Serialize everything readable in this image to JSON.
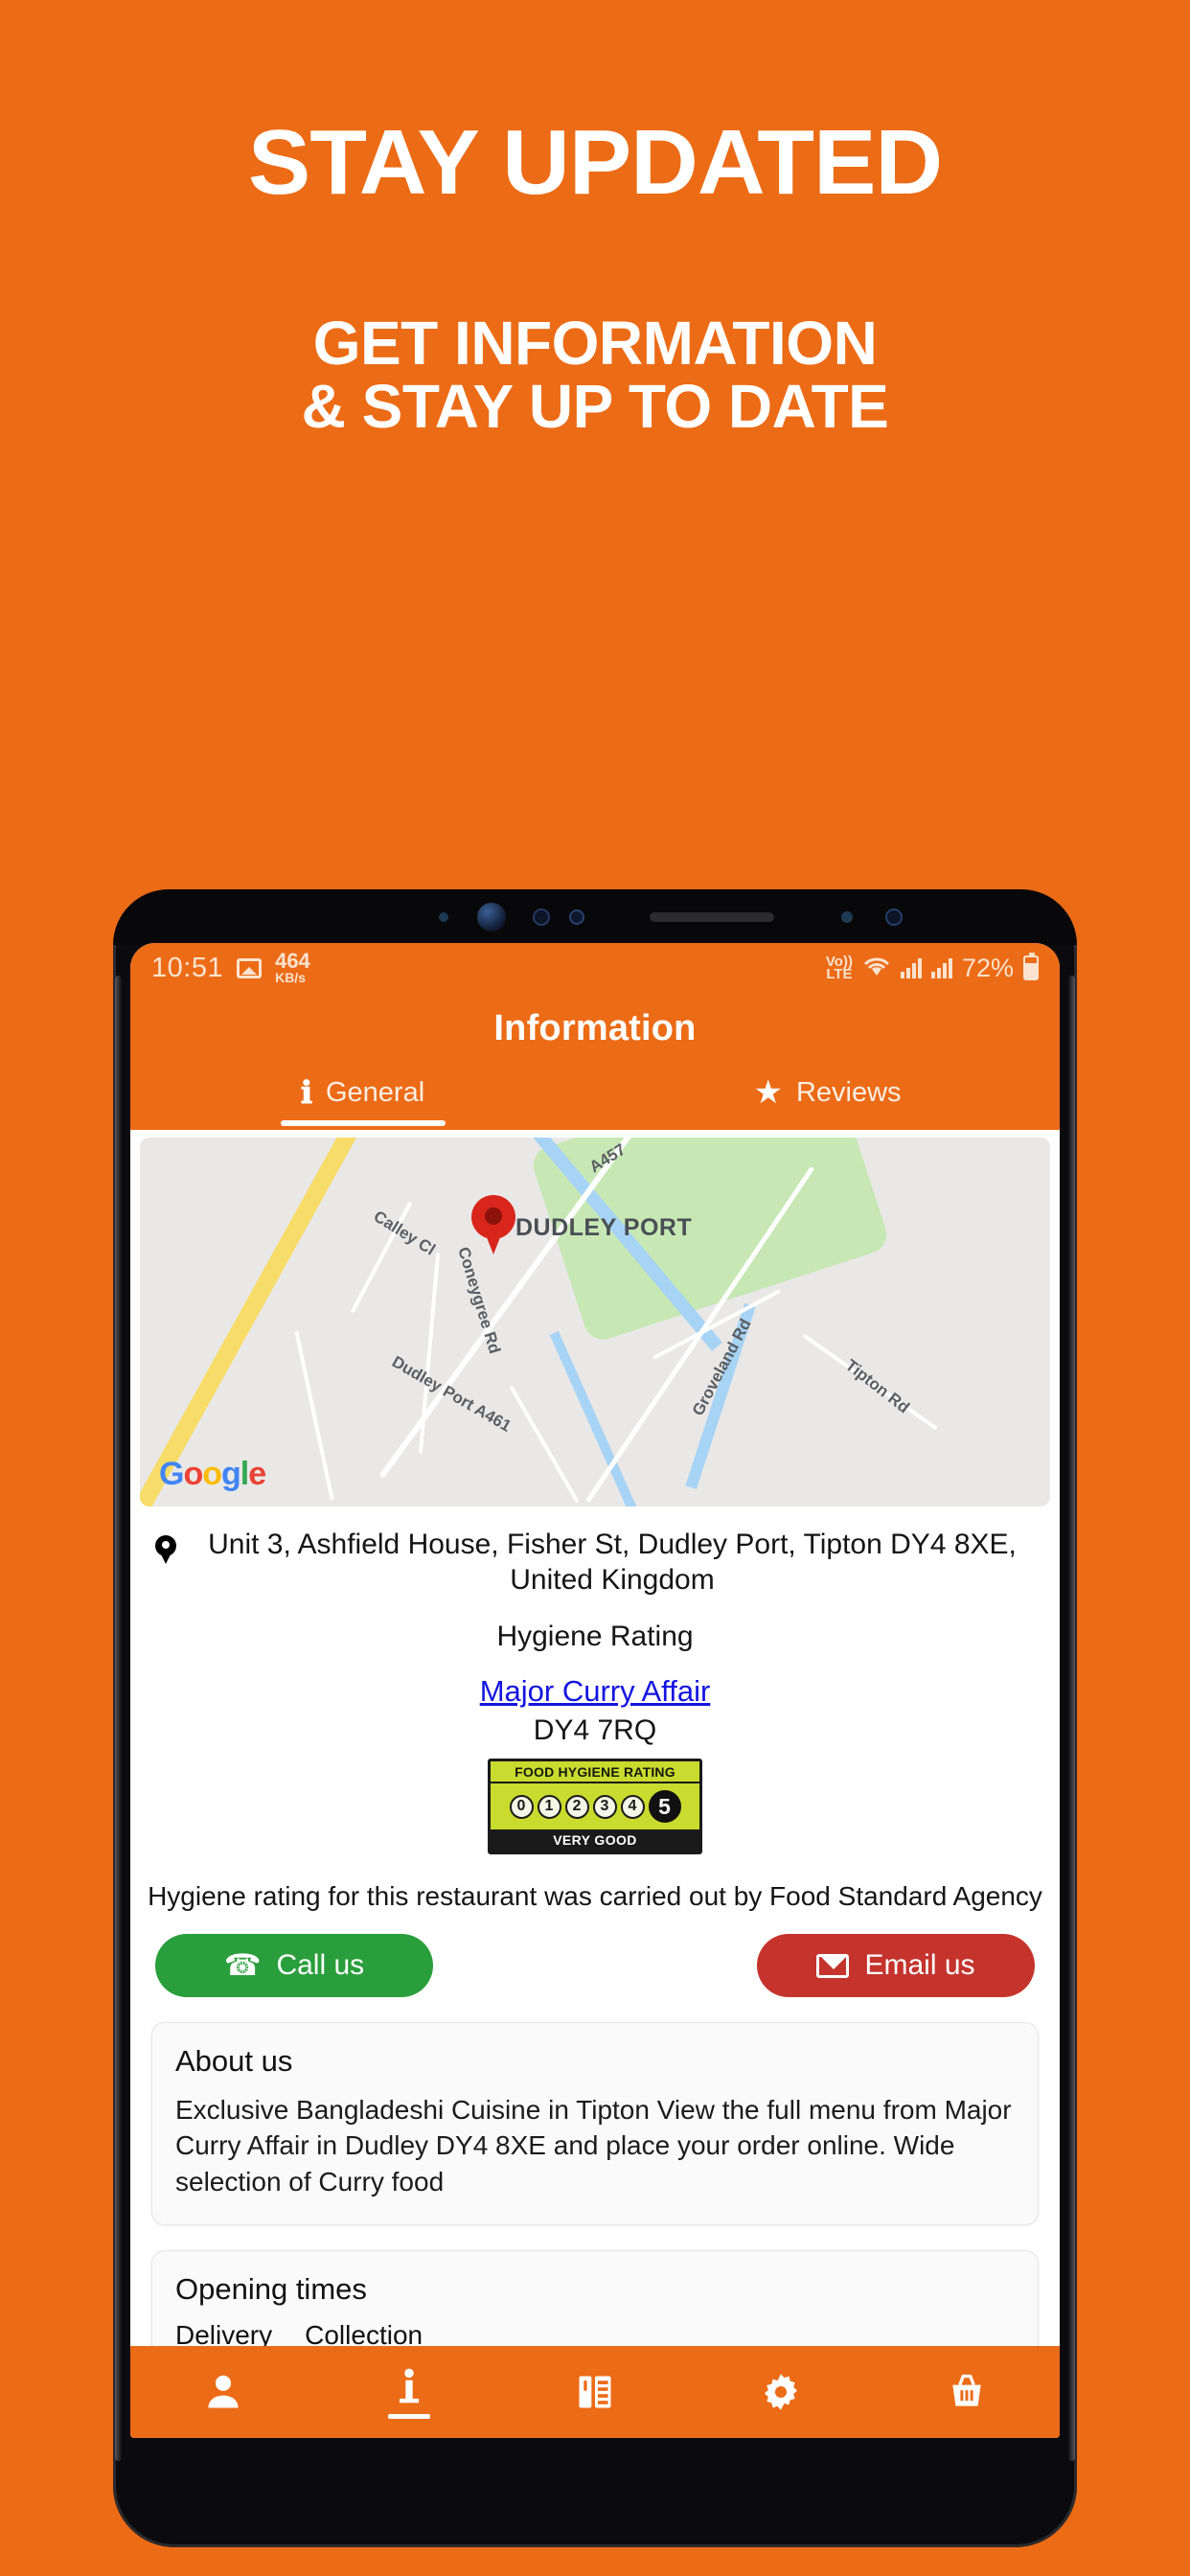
{
  "promo": {
    "title": "STAY UPDATED",
    "subtitle_line1": "GET INFORMATION",
    "subtitle_line2": "& STAY UP TO DATE",
    "background_color": "#EC6B16"
  },
  "status_bar": {
    "time": "10:51",
    "image_icon": "image-icon",
    "network_speed_value": "464",
    "network_speed_unit": "KB/s",
    "volte_top": "Vo))",
    "volte_bottom": "LTE",
    "wifi_icon": "wifi-icon",
    "signal_icon_1": "signal-bars-icon",
    "signal_icon_2": "signal-bars-icon",
    "battery_percent": "72%",
    "battery_icon": "battery-icon"
  },
  "app": {
    "title": "Information",
    "accent_color": "#EC6B16",
    "tabs": [
      {
        "label": "General",
        "icon": "info-icon",
        "active": true
      },
      {
        "label": "Reviews",
        "icon": "star-icon",
        "active": false
      }
    ]
  },
  "map": {
    "provider_logo": "Google",
    "place_label": "DUDLEY PORT",
    "pin_icon": "map-pin-icon",
    "street_labels": [
      "A457",
      "Calley Cl",
      "Coneygree Rd",
      "Dudley Port  A461",
      "A461",
      "Groveland Rd",
      "Tipton Rd"
    ]
  },
  "address": {
    "pin_icon": "location-pin-icon",
    "line1": "Unit 3, Ashfield House, Fisher St, Dudley Port, Tipton",
    "line2": "DY4 8XE, United Kingdom"
  },
  "hygiene": {
    "heading": "Hygiene Rating",
    "link_text": "Major Curry Affair",
    "postcode": "DY4 7RQ",
    "badge": {
      "header": "FOOD HYGIENE RATING",
      "scores": [
        "0",
        "1",
        "2",
        "3",
        "4",
        "5"
      ],
      "selected_score": "5",
      "footer": "VERY GOOD",
      "green_color": "#C9DB2E"
    },
    "note": "Hygiene rating for this restaurant was carried out by Food Standard Agency"
  },
  "contact": {
    "call_label": "Call us",
    "call_icon": "phone-icon",
    "call_color": "#2A9E3C",
    "email_label": "Email us",
    "email_icon": "email-icon",
    "email_color": "#C4342D"
  },
  "about": {
    "title": "About us",
    "body": "Exclusive Bangladeshi Cuisine in Tipton View the full menu from Major Curry Affair in Dudley DY4 8XE and place your order online. Wide selection of Curry food"
  },
  "opening_times": {
    "title": "Opening times",
    "tabs": [
      {
        "label": "Delivery",
        "active": true
      },
      {
        "label": "Collection",
        "active": false
      }
    ]
  },
  "bottom_nav": [
    {
      "icon": "person-icon",
      "active": false
    },
    {
      "icon": "info-icon",
      "active": true
    },
    {
      "icon": "menu-card-icon",
      "active": false
    },
    {
      "icon": "gear-icon",
      "active": false
    },
    {
      "icon": "basket-icon",
      "active": false
    }
  ]
}
